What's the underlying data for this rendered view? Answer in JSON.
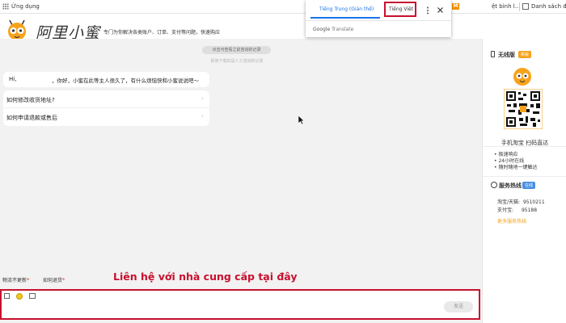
{
  "browser": {
    "apps_label": "Ứng dụng",
    "bookmark_1": "ệt bình l...",
    "bookmark_2": "Danh sách đọc"
  },
  "translate": {
    "tab_source": "Tiếng Trung (Giản thể)",
    "tab_target": "Tiếng Việt",
    "brand": "Google",
    "brand_suffix": "Translate"
  },
  "header": {
    "logo_text": "阿里小蜜",
    "slogan": "专门为你解决各类账户、订单、支付等问题，快速购应"
  },
  "chat": {
    "history_pill": "点击可查看之前咨询的记录",
    "history_note": "即使下载的是人工咨询的记录",
    "greeting_prefix": "Hi,",
    "greeting_text": "，你好，小蜜在此等主人很久了，有什么烦恼快和小蜜说说吧～",
    "faq": [
      {
        "text": "如何修改收货地址?",
        "arrow": "›"
      },
      {
        "text": "如何申请退款或售后",
        "arrow": "›"
      }
    ],
    "quick_tags": [
      {
        "text": "物流不更新",
        "mark": "*"
      },
      {
        "text": "如何退货",
        "mark": "*"
      }
    ],
    "annotation": "Liên hệ với nhà cung cấp tại đây",
    "send_label": "发送"
  },
  "sidebar": {
    "wireless_title": "无线版",
    "wireless_badge": "新版",
    "qr_caption": "手机淘宝 扫码直达",
    "features": [
      "极速响应",
      "24小时在线",
      "随时随地一键触达"
    ],
    "hotline_title": "服务热线",
    "hotline_badge": "在线",
    "phones": [
      {
        "label": "淘宝/天猫:",
        "number": "9510211"
      },
      {
        "label": "支付宝:",
        "number": "95188"
      }
    ],
    "more_link": "更多服务热线"
  },
  "colors": {
    "accent_orange": "#f7a21b",
    "annotation_red": "#c8102e",
    "translate_blue": "#1a73e8"
  }
}
